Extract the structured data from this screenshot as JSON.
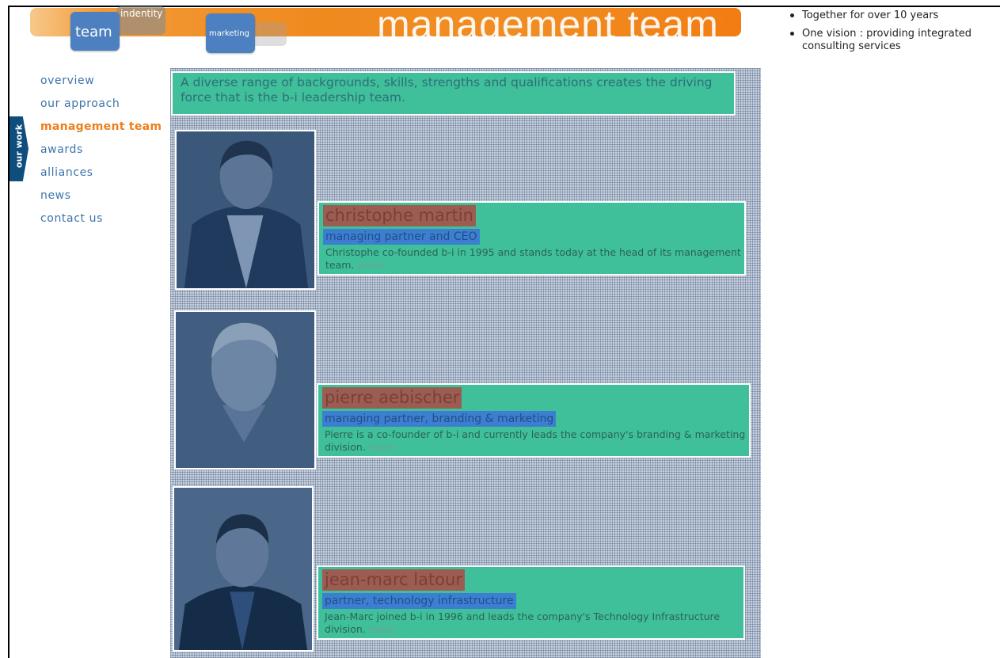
{
  "header": {
    "title": "management team",
    "tiles": {
      "team": "team",
      "identity": "indentity",
      "marketing": "marketing"
    }
  },
  "bullets": [
    "Together for over 10 years",
    "One vision : providing integrated consulting services"
  ],
  "side_tab": {
    "label": "our work"
  },
  "nav": {
    "items": [
      "overview",
      "our approach",
      "management team",
      "awards",
      "alliances",
      "news",
      "contact us"
    ],
    "active": "management team"
  },
  "intro": "A diverse range of backgrounds, skills, strengths and qualifications creates the driving force that is the b-i leadership team.",
  "team": [
    {
      "name": "christophe martin",
      "role": "managing partner and CEO",
      "desc": "Christophe co-founded b-i in 1995 and stands today at the head of its management team.",
      "more": "more"
    },
    {
      "name": "pierre aebischer",
      "role": "managing partner, branding & marketing",
      "desc": "Pierre is a co-founder of b-i and currently leads the company's branding & marketing division.",
      "more": "more"
    },
    {
      "name": "jean-marc latour",
      "role": "partner, technology infrastructure",
      "desc": "Jean-Marc joined b-i in 1996 and leads the company's Technology Infrastructure division.",
      "more": "more"
    }
  ],
  "colors": {
    "accent_orange": "#ee7e1b",
    "nav_blue": "#3d74ab",
    "card_green": "#3fbf9a",
    "tile_blue": "#4d80c0"
  }
}
